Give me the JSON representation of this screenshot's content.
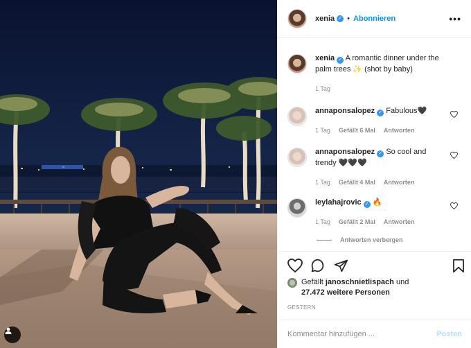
{
  "post": {
    "username": "xenia",
    "follow_label": "Abonnieren",
    "more_label": "•••"
  },
  "caption": {
    "username": "xenia",
    "text": "A romantic dinner under the palm trees ✨ (shot by baby)",
    "time": "1 Tag"
  },
  "comments": [
    {
      "username": "annaponsalopez",
      "text": "Fabulous🖤",
      "time": "1 Tag",
      "likes": "Gefällt 6 Mal",
      "reply": "Antworten"
    },
    {
      "username": "annaponsalopez",
      "text": "So cool and trendy 🖤🖤🖤",
      "time": "1 Tag",
      "likes": "Gefällt 4 Mal",
      "reply": "Antworten"
    },
    {
      "username": "leylahajrovic",
      "text": "🔥",
      "time": "1 Tag",
      "likes": "Gefällt 2 Mal",
      "reply": "Antworten"
    }
  ],
  "hide_replies": "Antworten verbergen",
  "likes": {
    "prefix": "Gefällt",
    "user": "janoschnietlispach",
    "suffix": "und",
    "count": "27.472 weitere Personen"
  },
  "date": "GESTERN",
  "add_comment": {
    "placeholder": "Kommentar hinzufügen ...",
    "post_label": "Posten"
  },
  "icons": {
    "verified": "verified-badge-icon",
    "like": "heart-icon",
    "comment": "comment-bubble-icon",
    "share": "paper-plane-icon",
    "save": "bookmark-icon",
    "tag": "person-tag-icon"
  },
  "colors": {
    "accent": "#0095f6",
    "verified": "#3897f0",
    "muted": "#8e8e8e"
  }
}
